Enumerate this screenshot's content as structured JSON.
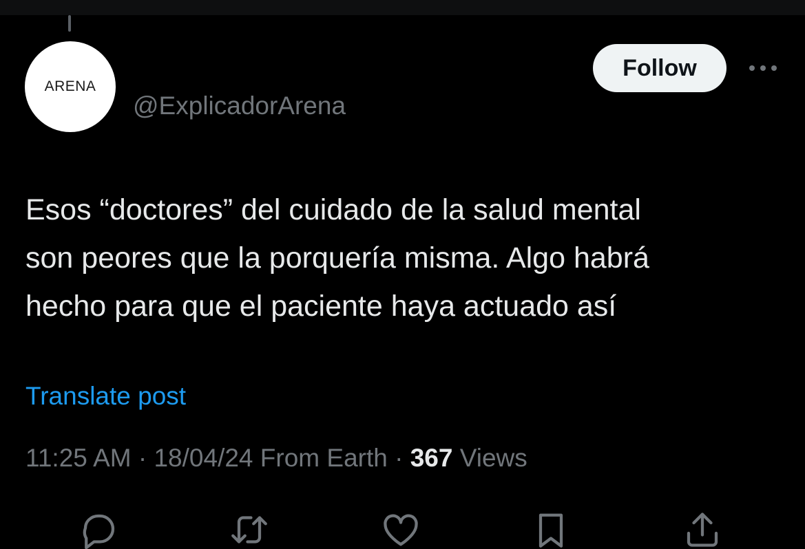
{
  "author": {
    "avatar_text": "ARENA",
    "handle": "@ExplicadorArena"
  },
  "follow_button": {
    "label": "Follow"
  },
  "post": {
    "lines": [
      "Esos “doctores” del cuidado de la salud mental",
      "son peores que la porquería misma. Algo habrá",
      "hecho para que el paciente haya actuado así"
    ]
  },
  "translate_link": "Translate post",
  "meta": {
    "time": "11:25 AM",
    "separator": "·",
    "date": "18/04/24",
    "source": "From Earth",
    "views_count": "367",
    "views_label": "Views"
  },
  "icons": {
    "more": "more-horizontal-icon",
    "reply": "reply-icon",
    "repost": "repost-icon",
    "like": "heart-icon",
    "bookmark": "bookmark-icon",
    "share": "share-icon"
  },
  "colors": {
    "background": "#000000",
    "text": "#e7e9ea",
    "secondary": "#71767b",
    "link": "#1d9bf0",
    "follow_bg": "#eff3f4"
  }
}
